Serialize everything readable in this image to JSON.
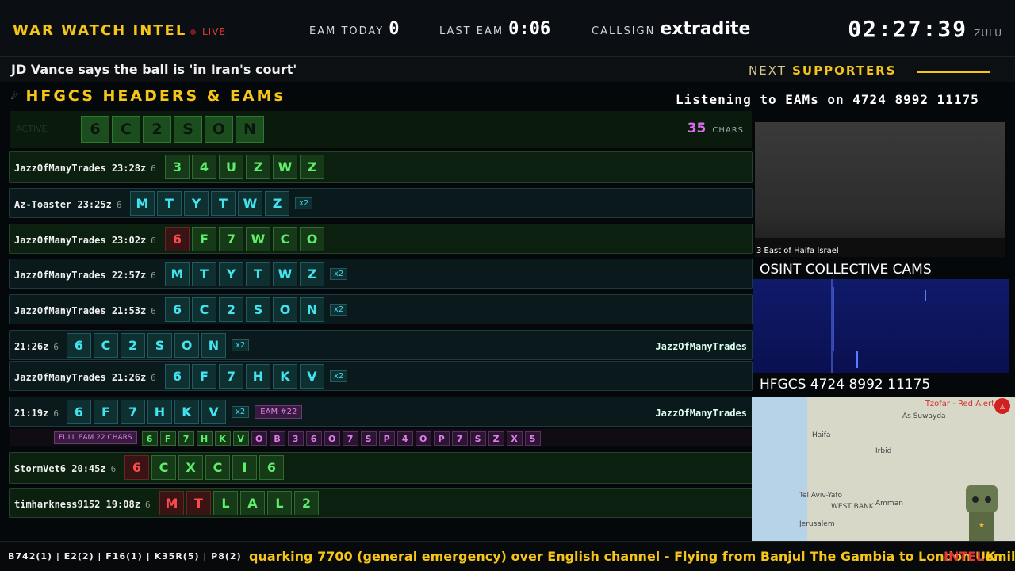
{
  "header": {
    "brand": "WAR WATCH INTEL",
    "live": "LIVE",
    "eam_today_label": "EAM TODAY",
    "eam_today": "0",
    "last_eam_label": "LAST EAM",
    "last_eam": "0:06",
    "callsign_label": "CALLSIGN",
    "callsign": "extradite",
    "time": "02:27:39",
    "zone": "ZULU"
  },
  "headline": {
    "text": "JD Vance says the ball is 'in Iran's court'",
    "next_a": "NEXT",
    "next_b": "SUPPORTERS"
  },
  "panel": {
    "title": "HFGCS HEADERS & EAMs",
    "listening": "Listening to EAMs on 4724 8992 11175"
  },
  "active": {
    "label": "ACTIVE",
    "chars": [
      "6",
      "C",
      "2",
      "S",
      "O",
      "N"
    ],
    "count": "35",
    "count_label": "CHARS"
  },
  "rows": [
    {
      "who": "JazzOfManyTrades 23:28z",
      "len": "6",
      "chars": [
        {
          "v": "3",
          "c": "g"
        },
        {
          "v": "4",
          "c": "g"
        },
        {
          "v": "U",
          "c": "g"
        },
        {
          "v": "Z",
          "c": "g"
        },
        {
          "v": "W",
          "c": "g"
        },
        {
          "v": "Z",
          "c": "g"
        }
      ],
      "x2": "",
      "eam": "",
      "by": ""
    },
    {
      "who": "Az-Toaster 23:25z",
      "len": "6",
      "chars": [
        {
          "v": "M",
          "c": "b"
        },
        {
          "v": "T",
          "c": "b"
        },
        {
          "v": "Y",
          "c": "b"
        },
        {
          "v": "T",
          "c": "b"
        },
        {
          "v": "W",
          "c": "b"
        },
        {
          "v": "Z",
          "c": "b"
        }
      ],
      "x2": "x2",
      "eam": "",
      "by": ""
    },
    {
      "who": "JazzOfManyTrades 23:02z",
      "len": "6",
      "chars": [
        {
          "v": "6",
          "c": "r"
        },
        {
          "v": "F",
          "c": "g"
        },
        {
          "v": "7",
          "c": "g"
        },
        {
          "v": "W",
          "c": "g"
        },
        {
          "v": "C",
          "c": "g"
        },
        {
          "v": "O",
          "c": "g"
        }
      ],
      "x2": "",
      "eam": "",
      "by": ""
    },
    {
      "who": "JazzOfManyTrades 22:57z",
      "len": "6",
      "chars": [
        {
          "v": "M",
          "c": "b"
        },
        {
          "v": "T",
          "c": "b"
        },
        {
          "v": "Y",
          "c": "b"
        },
        {
          "v": "T",
          "c": "b"
        },
        {
          "v": "W",
          "c": "b"
        },
        {
          "v": "Z",
          "c": "b"
        }
      ],
      "x2": "x2",
      "eam": "",
      "by": ""
    },
    {
      "who": "JazzOfManyTrades 21:53z",
      "len": "6",
      "chars": [
        {
          "v": "6",
          "c": "b"
        },
        {
          "v": "C",
          "c": "b"
        },
        {
          "v": "2",
          "c": "b"
        },
        {
          "v": "S",
          "c": "b"
        },
        {
          "v": "O",
          "c": "b"
        },
        {
          "v": "N",
          "c": "b"
        }
      ],
      "x2": "x2",
      "eam": "",
      "by": ""
    },
    {
      "who": "21:26z",
      "len": "6",
      "chars": [
        {
          "v": "6",
          "c": "b"
        },
        {
          "v": "C",
          "c": "b"
        },
        {
          "v": "2",
          "c": "b"
        },
        {
          "v": "S",
          "c": "b"
        },
        {
          "v": "O",
          "c": "b"
        },
        {
          "v": "N",
          "c": "b"
        }
      ],
      "x2": "x2",
      "eam": "",
      "by": "JazzOfManyTrades"
    },
    {
      "who": "JazzOfManyTrades 21:26z",
      "len": "6",
      "chars": [
        {
          "v": "6",
          "c": "b"
        },
        {
          "v": "F",
          "c": "b"
        },
        {
          "v": "7",
          "c": "b"
        },
        {
          "v": "H",
          "c": "b"
        },
        {
          "v": "K",
          "c": "b"
        },
        {
          "v": "V",
          "c": "b"
        }
      ],
      "x2": "x2",
      "eam": "",
      "by": ""
    },
    {
      "who": "21:19z",
      "len": "6",
      "chars": [
        {
          "v": "6",
          "c": "b"
        },
        {
          "v": "F",
          "c": "b"
        },
        {
          "v": "7",
          "c": "b"
        },
        {
          "v": "H",
          "c": "b"
        },
        {
          "v": "K",
          "c": "b"
        },
        {
          "v": "V",
          "c": "b"
        }
      ],
      "x2": "x2",
      "eam": "EAM #22",
      "by": "JazzOfManyTrades"
    },
    {
      "who": "StormVet6 20:45z",
      "len": "6",
      "chars": [
        {
          "v": "6",
          "c": "r"
        },
        {
          "v": "C",
          "c": "g"
        },
        {
          "v": "X",
          "c": "g"
        },
        {
          "v": "C",
          "c": "g"
        },
        {
          "v": "I",
          "c": "g"
        },
        {
          "v": "6",
          "c": "g"
        }
      ],
      "x2": "",
      "eam": "",
      "by": ""
    },
    {
      "who": "timharkness9152 19:08z",
      "len": "6",
      "chars": [
        {
          "v": "M",
          "c": "r"
        },
        {
          "v": "T",
          "c": "r"
        },
        {
          "v": "L",
          "c": "g"
        },
        {
          "v": "A",
          "c": "g"
        },
        {
          "v": "L",
          "c": "g"
        },
        {
          "v": "2",
          "c": "g"
        }
      ],
      "x2": "",
      "eam": "",
      "by": ""
    }
  ],
  "full_eam": {
    "label": "FULL EAM 22 CHARS",
    "chars": [
      "6",
      "F",
      "7",
      "H",
      "K",
      "V",
      "O",
      "B",
      "3",
      "6",
      "O",
      "7",
      "S",
      "P",
      "4",
      "O",
      "P",
      "7",
      "S",
      "Z",
      "X",
      "5"
    ]
  },
  "right": {
    "cam_label": "3 East of Haifa Israel",
    "osint": "OSINT COLLECTIVE CAMS",
    "hfgcs": "HFGCS 4724 8992 11175",
    "map_alert": "Tzofar - Red Alert",
    "map_places": [
      "Haifa",
      "Irbid",
      "Tel Aviv-Yafo",
      "WEST BANK",
      "Amman",
      "Jerusalem",
      "As Suwayda"
    ]
  },
  "ticker": {
    "codes": "B742(1) | E2(2) | F16(1) | K35R(5) | P8(2)",
    "news": "quarking 7700 (general emergency) over English channel - Flying from Banjul The Gambia to London UK",
    "intel": "INTEL",
    "emil": "emil"
  }
}
